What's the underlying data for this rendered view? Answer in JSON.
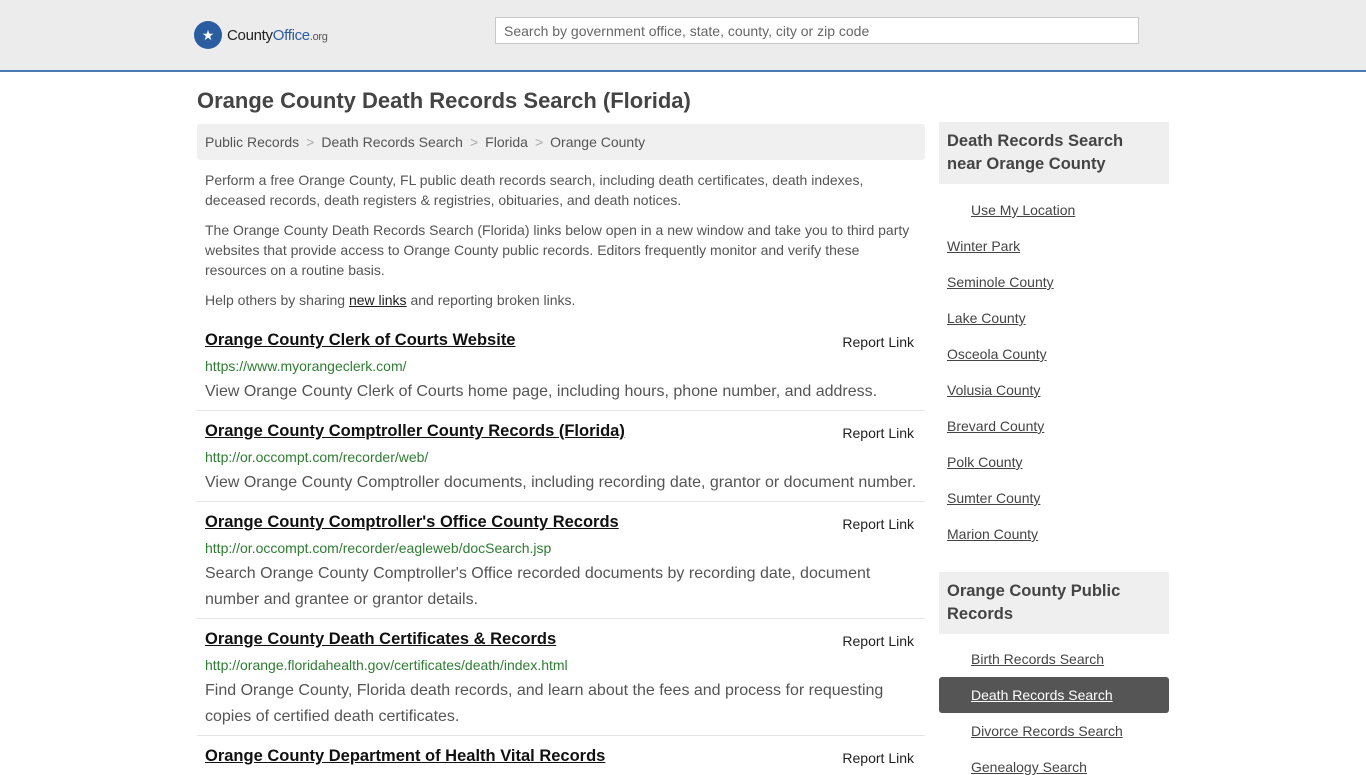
{
  "header": {
    "logo_main": "County",
    "logo_accent": "Office",
    "logo_tld": ".org",
    "search_placeholder": "Search by government office, state, county, city or zip code"
  },
  "page": {
    "title": "Orange County Death Records Search (Florida)"
  },
  "breadcrumb": [
    "Public Records",
    "Death Records Search",
    "Florida",
    "Orange County"
  ],
  "intro": {
    "p1": "Perform a free Orange County, FL public death records search, including death certificates, death indexes, deceased records, death registers & registries, obituaries, and death notices.",
    "p2": "The Orange County Death Records Search (Florida) links below open in a new window and take you to third party websites that provide access to Orange County public records. Editors frequently monitor and verify these resources on a routine basis.",
    "p3_before": "Help others by sharing ",
    "p3_link": "new links",
    "p3_after": " and reporting broken links."
  },
  "report_label": "Report Link",
  "entries": [
    {
      "title": "Orange County Clerk of Courts Website",
      "url": "https://www.myorangeclerk.com/",
      "desc": "View Orange County Clerk of Courts home page, including hours, phone number, and address."
    },
    {
      "title": "Orange County Comptroller County Records (Florida)",
      "url": "http://or.occompt.com/recorder/web/",
      "desc": "View Orange County Comptroller documents, including recording date, grantor or document number."
    },
    {
      "title": "Orange County Comptroller's Office County Records",
      "url": "http://or.occompt.com/recorder/eagleweb/docSearch.jsp",
      "desc": "Search Orange County Comptroller's Office recorded documents by recording date, document number and grantee or grantor details."
    },
    {
      "title": "Orange County Death Certificates & Records",
      "url": "http://orange.floridahealth.gov/certificates/death/index.html",
      "desc": "Find Orange County, Florida death records, and learn about the fees and process for requesting copies of certified death certificates."
    },
    {
      "title": "Orange County Department of Health Vital Records",
      "url": "",
      "desc": ""
    }
  ],
  "sidebar": {
    "nearby_title": "Death Records Search near Orange County",
    "use_location": "Use My Location",
    "nearby": [
      "Winter Park",
      "Seminole County",
      "Lake County",
      "Osceola County",
      "Volusia County",
      "Brevard County",
      "Polk County",
      "Sumter County",
      "Marion County"
    ],
    "records_title": "Orange County Public Records",
    "records": [
      "Birth Records Search",
      "Death Records Search",
      "Divorce Records Search",
      "Genealogy Search"
    ],
    "active_index": 1
  }
}
